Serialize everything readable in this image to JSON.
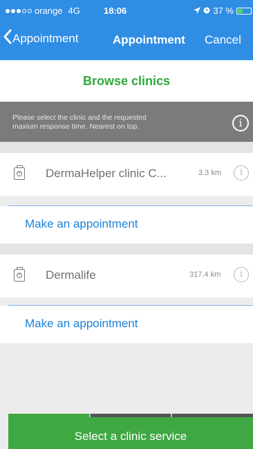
{
  "status_bar": {
    "carrier": "orange",
    "network": "4G",
    "time": "18:06",
    "location_icon": "location-arrow-icon",
    "alarm_icon": "alarm-icon",
    "battery_percent": "37 %",
    "battery_level": 0.37
  },
  "nav": {
    "back_label": "Appointment",
    "title": "Appointment",
    "cancel_label": "Cancel"
  },
  "browse_title": "Browse clinics",
  "info_banner": {
    "line1": "Please select the clinic and the requested",
    "line2": "maxium response time. Nearest on top."
  },
  "clinics": [
    {
      "name": "DermaHelper clinic C...",
      "distance": "3.3 km",
      "appointment_label": "Make an appointment"
    },
    {
      "name": "Dermalife",
      "distance": "317.4 km",
      "appointment_label": "Make an appointment"
    }
  ],
  "footer": {
    "label": "Select a clinic service",
    "progress_step": 1,
    "progress_total": 3
  },
  "colors": {
    "header": "#2f8de3",
    "accent_green": "#3fa843",
    "link_blue": "#1c82d9"
  }
}
